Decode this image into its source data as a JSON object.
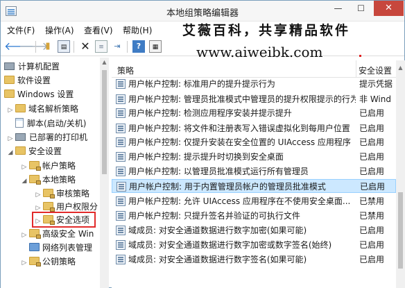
{
  "window": {
    "title": "本地组策略编辑器",
    "minimize": "—",
    "maximize": "☐",
    "close": "✕"
  },
  "menu": [
    "文件(F)",
    "操作(A)",
    "查看(V)",
    "帮助(H)"
  ],
  "overlay": {
    "slogan": "艾薇百科，共享精品软件",
    "url": "www.aiweibk.com"
  },
  "toolbar": {
    "back": "🡐",
    "forward": "🡒",
    "up": "▮",
    "tree": "▤",
    "delete": "✕",
    "properties": "≡",
    "export": "⇥",
    "help": "?",
    "view": "▦"
  },
  "tree": {
    "items": [
      {
        "label": "计算机配置",
        "icon": "computer-icon",
        "arrow": ""
      },
      {
        "label": "软件设置",
        "icon": "folder-icon",
        "arrow": ""
      },
      {
        "label": "Windows 设置",
        "icon": "folder-icon",
        "arrow": ""
      },
      {
        "label": "域名解析策略",
        "icon": "folder-icon",
        "arrow": "▷"
      },
      {
        "label": "脚本(启动/关机)",
        "icon": "document-icon",
        "arrow": ""
      },
      {
        "label": "已部署的打印机",
        "icon": "printer-icon",
        "arrow": "▷"
      },
      {
        "label": "安全设置",
        "icon": "folder-icon",
        "arrow": "◢"
      },
      {
        "label": "帐户策略",
        "icon": "locked-folder-icon",
        "arrow": "▷"
      },
      {
        "label": "本地策略",
        "icon": "locked-folder-icon",
        "arrow": "◢"
      },
      {
        "label": "审核策略",
        "icon": "locked-folder-icon",
        "arrow": "▷"
      },
      {
        "label": "用户权限分",
        "icon": "locked-folder-icon",
        "arrow": "▷"
      },
      {
        "label": "安全选项",
        "icon": "locked-folder-icon",
        "arrow": "▷"
      },
      {
        "label": "高级安全 Win",
        "icon": "locked-folder-icon",
        "arrow": "▷"
      },
      {
        "label": "网络列表管理",
        "icon": "folder-icon",
        "arrow": ""
      },
      {
        "label": "公钥策略",
        "icon": "locked-folder-icon",
        "arrow": "▷"
      }
    ]
  },
  "list": {
    "columns": [
      "策略",
      "安全设置"
    ],
    "rows": [
      {
        "policy": "用户帐户控制: 标准用户的提升提示行为",
        "setting": "提示凭据"
      },
      {
        "policy": "用户帐户控制: 管理员批准模式中管理员的提升权限提示的行为",
        "setting": "非 Wind"
      },
      {
        "policy": "用户帐户控制: 检测应用程序安装并提示提升",
        "setting": "已启用"
      },
      {
        "policy": "用户帐户控制: 将文件和注册表写入错误虚拟化到每用户位置",
        "setting": "已启用"
      },
      {
        "policy": "用户帐户控制: 仅提升安装在安全位置的 UIAccess 应用程序",
        "setting": "已启用"
      },
      {
        "policy": "用户帐户控制: 提示提升时切换到安全桌面",
        "setting": "已启用"
      },
      {
        "policy": "用户帐户控制: 以管理员批准模式运行所有管理员",
        "setting": "已启用"
      },
      {
        "policy": "用户帐户控制: 用于内置管理员帐户的管理员批准模式",
        "setting": "已启用",
        "selected": true
      },
      {
        "policy": "用户帐户控制: 允许 UIAccess 应用程序在不使用安全桌面...",
        "setting": "已禁用"
      },
      {
        "policy": "用户帐户控制: 只提升签名并验证的可执行文件",
        "setting": "已禁用"
      },
      {
        "policy": "域成员: 对安全通道数据进行数字加密(如果可能)",
        "setting": "已启用"
      },
      {
        "policy": "域成员: 对安全通道数据进行数字加密或数字签名(始终)",
        "setting": "已启用"
      },
      {
        "policy": "域成员: 对安全通道数据进行数字签名(如果可能)",
        "setting": "已启用"
      }
    ]
  },
  "colors": {
    "selection": "#cce8ff",
    "highlight_box": "#e12a2a",
    "close_button": "#c7473d"
  }
}
